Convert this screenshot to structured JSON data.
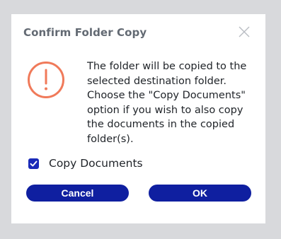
{
  "dialog": {
    "title": "Confirm Folder Copy",
    "close_icon": "close-icon",
    "alert_icon": "exclamation-circle-icon",
    "message": "The folder will be copied to the selected destination folder. Choose the \"Copy Documents\" option if you wish to also copy the documents in the copied folder(s).",
    "checkbox": {
      "label": "Copy Documents",
      "checked": true
    },
    "buttons": {
      "cancel_label": "Cancel",
      "ok_label": "OK"
    }
  },
  "colors": {
    "accent": "#0f1fa0",
    "alert": "#f07a5a",
    "title": "#636a73",
    "backdrop": "#d8d9dc"
  }
}
